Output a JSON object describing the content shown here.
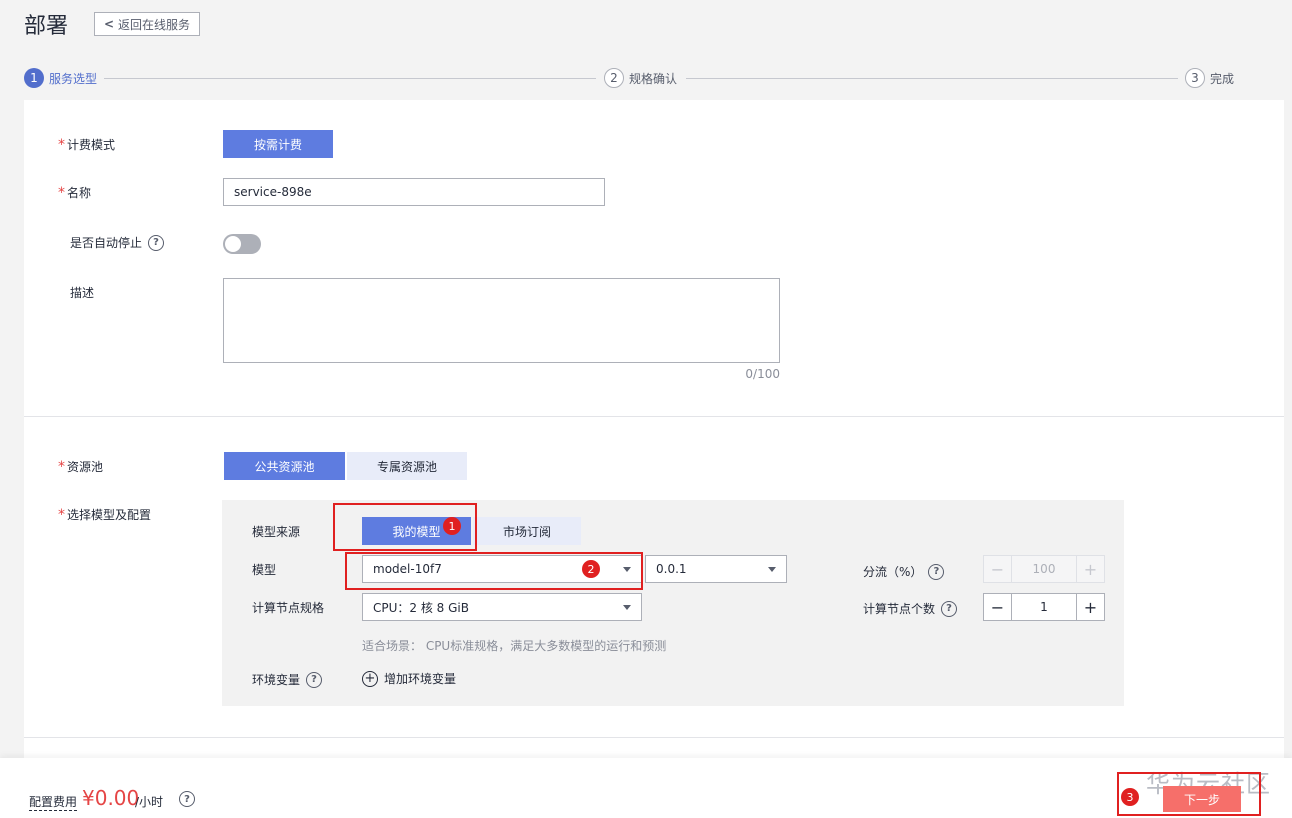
{
  "header": {
    "title": "部署",
    "back_label": "返回在线服务"
  },
  "steps": [
    {
      "num": "1",
      "label": "服务选型"
    },
    {
      "num": "2",
      "label": "规格确认"
    },
    {
      "num": "3",
      "label": "完成"
    }
  ],
  "form": {
    "billing_label": "计费模式",
    "billing_value": "按需计费",
    "name_label": "名称",
    "name_value": "service-898e",
    "auto_stop_label": "是否自动停止",
    "auto_stop_on": false,
    "desc_label": "描述",
    "desc_counter": "0/100",
    "pool_label": "资源池",
    "pool_public": "公共资源池",
    "pool_dedicated": "专属资源池",
    "model_config_label": "选择模型及配置"
  },
  "config": {
    "source_label": "模型来源",
    "source_mine": "我的模型",
    "source_market": "市场订阅",
    "model_label": "模型",
    "model_value": "model-10f7",
    "version_value": "0.0.1",
    "traffic_label": "分流（%）",
    "traffic_value": "100",
    "spec_label": "计算节点规格",
    "spec_value": "CPU：2 核 8 GiB",
    "node_count_label": "计算节点个数",
    "node_count_value": "1",
    "spec_hint": "适合场景： CPU标准规格，满足大多数模型的运行和预测",
    "env_label": "环境变量",
    "env_add": "增加环境变量"
  },
  "annotations": [
    "1",
    "2",
    "3"
  ],
  "footer": {
    "fee_label": "配置费用",
    "fee_value": "¥0.00",
    "fee_unit": "/小时",
    "next_label": "下一步",
    "watermark": "华为云社区"
  },
  "colors": {
    "primary": "#5e7ce0",
    "danger": "#e54545",
    "annotation": "#e02020"
  }
}
